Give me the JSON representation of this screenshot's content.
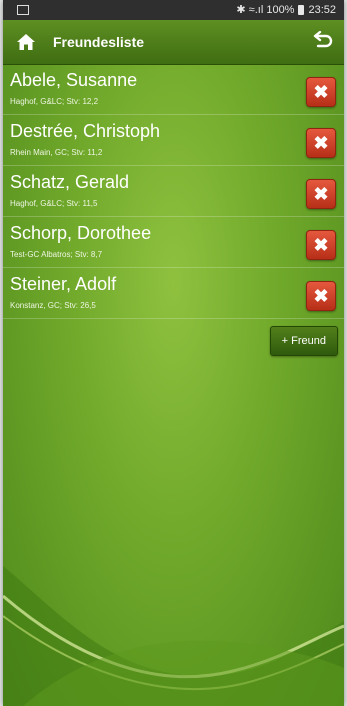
{
  "status_bar": {
    "right_text": "✱ ≈.ıl 100%",
    "time": "23:52"
  },
  "header": {
    "title": "Freundesliste",
    "home_icon": "home-icon",
    "back_icon": "undo-arrow-icon"
  },
  "friends": [
    {
      "name": "Abele, Susanne",
      "detail": "Haghof, G&LC; Stv: 12,2"
    },
    {
      "name": "Destrée, Christoph",
      "detail": "Rhein Main, GC; Stv: 11,2"
    },
    {
      "name": "Schatz, Gerald",
      "detail": "Haghof, G&LC; Stv: 11,5"
    },
    {
      "name": "Schorp, Dorothee",
      "detail": "Test-GC Albatros; Stv: 8,7"
    },
    {
      "name": "Steiner, Adolf",
      "detail": "Konstanz, GC; Stv: 26,5"
    }
  ],
  "delete_label": "✖",
  "add_friend_label": "+ Freund",
  "colors": {
    "accent": "#6fa82a",
    "header": "#4a7a18",
    "delete": "#d9452a"
  }
}
